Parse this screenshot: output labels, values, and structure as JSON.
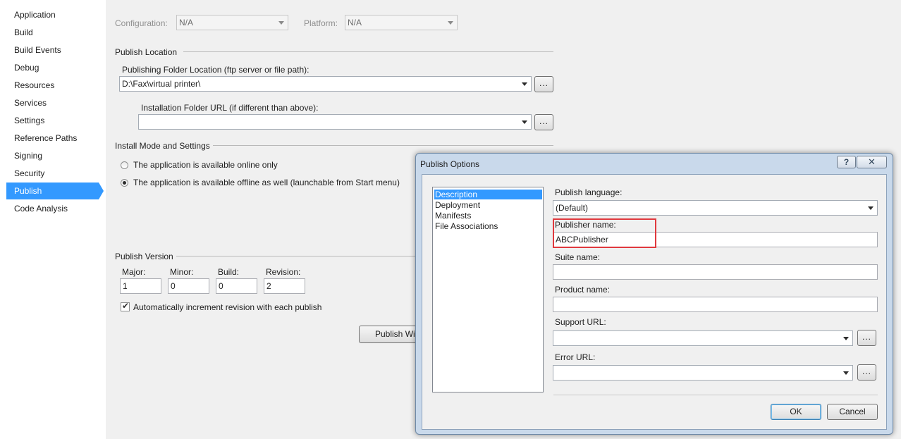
{
  "sidebar": {
    "items": [
      {
        "label": "Application"
      },
      {
        "label": "Build"
      },
      {
        "label": "Build Events"
      },
      {
        "label": "Debug"
      },
      {
        "label": "Resources"
      },
      {
        "label": "Services"
      },
      {
        "label": "Settings"
      },
      {
        "label": "Reference Paths"
      },
      {
        "label": "Signing"
      },
      {
        "label": "Security"
      },
      {
        "label": "Publish"
      },
      {
        "label": "Code Analysis"
      }
    ],
    "active": "Publish"
  },
  "top": {
    "configuration_label": "Configuration:",
    "configuration_value": "N/A",
    "platform_label": "Platform:",
    "platform_value": "N/A"
  },
  "publish_location": {
    "title": "Publish Location",
    "folder_label": "Publishing Folder Location (ftp server or file path):",
    "folder_value": "D:\\Fax\\virtual printer\\",
    "install_label": "Installation Folder URL (if different than above):",
    "install_value": "",
    "browse_label": "..."
  },
  "install_mode": {
    "title": "Install Mode and Settings",
    "online_label": "The application is available online only",
    "offline_label": "The application is available offline as well (launchable from Start menu)",
    "selected": "offline"
  },
  "publish_version": {
    "title": "Publish Version",
    "major_label": "Major:",
    "minor_label": "Minor:",
    "build_label": "Build:",
    "revision_label": "Revision:",
    "major": "1",
    "minor": "0",
    "build": "0",
    "revision": "2",
    "auto_increment_label": "Automatically increment revision with each publish",
    "auto_increment": true
  },
  "publish_wizard_label": "Publish Wi",
  "dialog": {
    "title": "Publish Options",
    "help_label": "?",
    "close_label": "✕",
    "categories": [
      "Description",
      "Deployment",
      "Manifests",
      "File Associations"
    ],
    "selected_category": "Description",
    "publish_language_label": "Publish language:",
    "publish_language_value": "(Default)",
    "publisher_name_label": "Publisher name:",
    "publisher_name_value": "ABCPublisher",
    "suite_name_label": "Suite name:",
    "suite_name_value": "",
    "product_name_label": "Product name:",
    "product_name_value": "",
    "support_url_label": "Support URL:",
    "support_url_value": "",
    "error_url_label": "Error URL:",
    "error_url_value": "",
    "browse_label": "...",
    "ok_label": "OK",
    "cancel_label": "Cancel"
  },
  "colors": {
    "accent": "#3399ff",
    "highlight_border": "#e0393e",
    "dialog_frame": "#c9d9eb"
  }
}
